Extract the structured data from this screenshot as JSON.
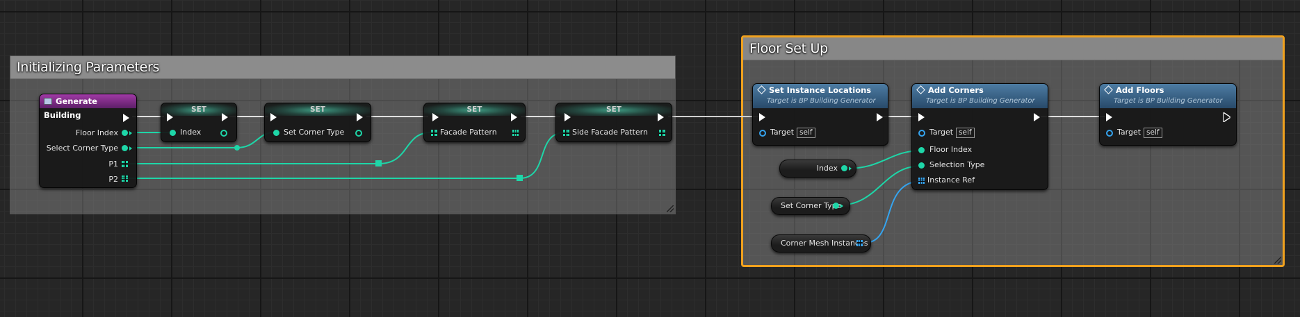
{
  "comments": {
    "init_title": "Initializing Parameters",
    "floor_title": "Floor Set Up"
  },
  "event_node": {
    "title": "Generate Building",
    "pins": [
      "Floor Index",
      "Select Corner Type",
      "P1",
      "P2"
    ]
  },
  "set_nodes": [
    {
      "title": "SET",
      "pin": "Index"
    },
    {
      "title": "SET",
      "pin": "Set Corner Type"
    },
    {
      "title": "SET",
      "pin": "Facade Pattern"
    },
    {
      "title": "SET",
      "pin": "Side Facade Pattern"
    }
  ],
  "func_nodes": [
    {
      "title": "Set Instance Locations",
      "subtitle": "Target is BP Building Generator",
      "target": "Target",
      "self": "self"
    },
    {
      "title": "Add Corners",
      "subtitle": "Target is BP Building Generator",
      "target": "Target",
      "self": "self",
      "inputs": [
        "Floor Index",
        "Selection Type",
        "Instance Ref"
      ]
    },
    {
      "title": "Add Floors",
      "subtitle": "Target is BP Building Generator",
      "target": "Target",
      "self": "self"
    }
  ],
  "var_nodes": [
    "Index",
    "Set Corner Type",
    "Corner Mesh Instances"
  ],
  "colors": {
    "background": "#262626",
    "exec": "#ffffff",
    "integer_pin": "#1ed6a8",
    "object_pin": "#35a4ef",
    "selection_outline": "#f0a11e",
    "event_header": "#a03aa5",
    "function_header": "#4d7ca3"
  }
}
